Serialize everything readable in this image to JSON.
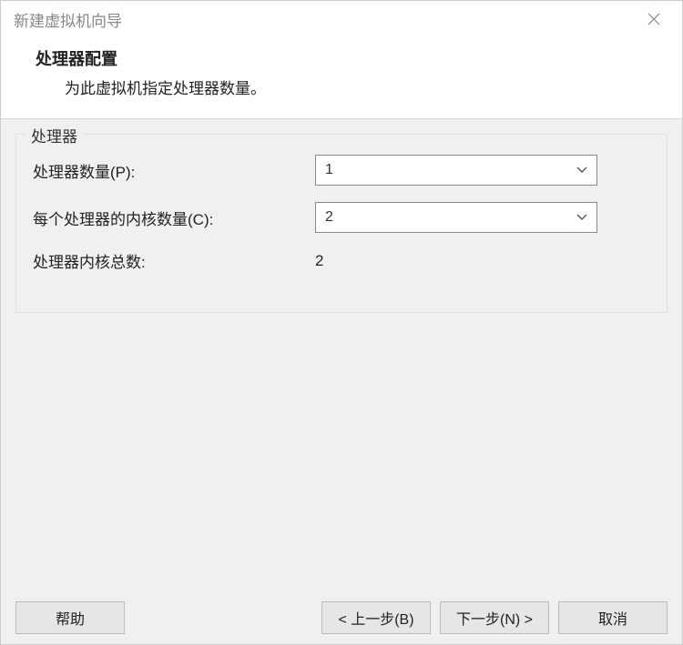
{
  "window": {
    "title": "新建虚拟机向导"
  },
  "header": {
    "title": "处理器配置",
    "subtitle": "为此虚拟机指定处理器数量。"
  },
  "group": {
    "legend": "处理器",
    "rows": {
      "procCount": {
        "label": "处理器数量(P):",
        "value": "1"
      },
      "coresPer": {
        "label": "每个处理器的内核数量(C):",
        "value": "2"
      },
      "totalCores": {
        "label": "处理器内核总数:",
        "value": "2"
      }
    }
  },
  "buttons": {
    "help": "帮助",
    "back": "< 上一步(B)",
    "next": "下一步(N) >",
    "cancel": "取消"
  }
}
